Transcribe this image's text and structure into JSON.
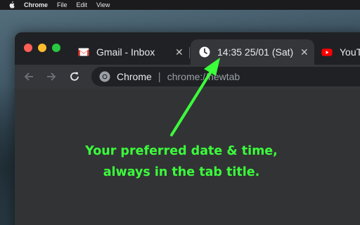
{
  "menubar": {
    "app_name": "Chrome",
    "items": [
      "File",
      "Edit",
      "View"
    ]
  },
  "tabs": [
    {
      "title": "Gmail - Inbox",
      "icon": "gmail-icon",
      "active": false
    },
    {
      "title": "14:35 25/01 (Sat)",
      "icon": "clock-icon",
      "active": true
    },
    {
      "title": "YouT",
      "icon": "youtube-icon",
      "active": false
    }
  ],
  "omnibox": {
    "site_name": "Chrome",
    "url": "chrome://newtab"
  },
  "annotation": {
    "line1": "Your preferred date & time,",
    "line2": "always in the tab title."
  },
  "colors": {
    "annotation_green": "#3bff3b",
    "tab_active": "#35363a",
    "window_frame": "#202124"
  }
}
